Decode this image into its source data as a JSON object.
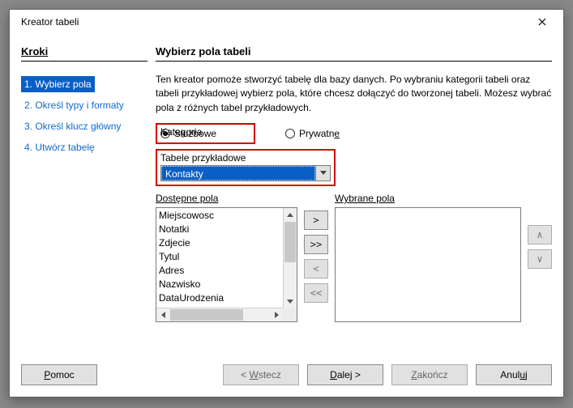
{
  "window": {
    "title": "Kreator tabeli"
  },
  "sidebar": {
    "heading": "Kroki",
    "steps": [
      "1. Wybierz pola",
      "2. Określ typy i formaty",
      "3. Określ klucz główny",
      "4. Utwórz tabelę"
    ],
    "active_index": 0
  },
  "main": {
    "heading": "Wybierz pola tabeli",
    "description": "Ten kreator pomoże stworzyć tabelę dla bazy danych. Po wybraniu kategorii tabeli oraz tabeli przykładowej wybierz pola, które chcesz dołączyć do tworzonej tabeli. Możesz wybrać pola z różnych tabel przykładowych.",
    "category": {
      "label": "Kategoria",
      "options": {
        "business": "Służbowe",
        "private": "Prywatne"
      },
      "selected": "business"
    },
    "sample_tables": {
      "label": "Tabele przykładowe",
      "value": "Kontakty"
    },
    "available": {
      "label": "Dostępne pola",
      "items": [
        "Miejscowosc",
        "Notatki",
        "Zdjecie",
        "Tytul",
        "Adres",
        "Nazwisko",
        "DataUrodzenia"
      ]
    },
    "selected": {
      "label": "Wybrane pola",
      "items": []
    },
    "transfer": {
      "add": ">",
      "add_all": ">>",
      "remove": "<",
      "remove_all": "<<"
    },
    "order": {
      "up": "∧",
      "down": "∨"
    }
  },
  "footer": {
    "help": "Pomoc",
    "back": "< Wstecz",
    "next": "Dalej >",
    "finish": "Zakończ",
    "cancel": "Anuluj"
  }
}
